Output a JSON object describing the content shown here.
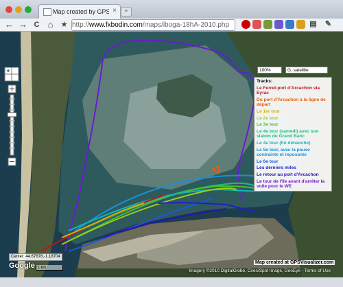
{
  "browser": {
    "tab_title": "Map created by GPS Visualiz...",
    "tab_close": "×",
    "new_tab": "+",
    "url_scheme": "http://",
    "url_domain": "www.fxbodin.com",
    "url_path": "/maps/iboga-18hA-2010.php",
    "nav": {
      "back": "←",
      "forward": "→",
      "reload": "C",
      "home": "⌂",
      "star": "★"
    }
  },
  "map": {
    "zoom_select": "100%",
    "maptype_select": "G. satellite",
    "center_readout": "Center: 44.67878,-1.18704",
    "google_logo": "Google",
    "scale_label": "1 km",
    "made_with": "Map created at GPSVisualizer.com",
    "attribution": "Imagery ©2010 DigitalGlobe, Cnes/Spot Image, GeoEye - Terms of Use",
    "tracks_header": "Tracks:",
    "tracks": [
      {
        "label": "Le Ferret-port d'Arcachon via Eyrac",
        "color": "#c0141c"
      },
      {
        "label": "Du port d'Arcachon à la ligne de départ",
        "color": "#e06010"
      },
      {
        "label": "Le 1er tour",
        "color": "#d8b000"
      },
      {
        "label": "Le 2e tour",
        "color": "#9ccd18"
      },
      {
        "label": "Le 3e tour",
        "color": "#4cc028"
      },
      {
        "label": "Le 4e tour (samedi) avec son slalom du Grand Banc",
        "color": "#18c080"
      },
      {
        "label": "Le 4e tour (fin dimanche)",
        "color": "#10b8b8"
      },
      {
        "label": "Le 5e tour, avec la pause contrainte et reposante",
        "color": "#1890d8"
      },
      {
        "label": "Le 6e tour",
        "color": "#1858d8"
      },
      {
        "label": "Les derniers miles",
        "color": "#2020c8"
      },
      {
        "label": "Le retour au port d'Arcachon",
        "color": "#3010b0"
      },
      {
        "label": "Le tour de l'île avant d'arrêter la voile pour le WE",
        "color": "#7818c8"
      }
    ]
  }
}
